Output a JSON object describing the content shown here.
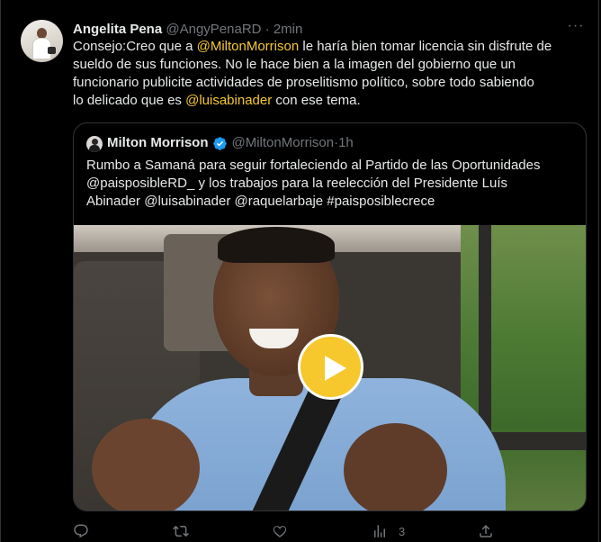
{
  "tweet": {
    "author_name": "Angelita Pena",
    "author_handle": "@AngyPenaRD",
    "separator": "·",
    "time": "2min",
    "more_label": "···",
    "text": {
      "line1_a": "Consejo:Creo que a ",
      "line1_mention": "@MiltonMorrison",
      "line1_b": " le haría bien tomar licencia sin disfrute de",
      "line2": "sueldo de sus funciones. No le hace bien a la imagen del gobierno que un",
      "line3": "funcionario publicite actividades de proselitismo político, sobre todo sabiendo",
      "line4_a": "lo delicado que es ",
      "line4_mention": "@luisabinader",
      "line4_b": " con ese tema."
    }
  },
  "quoted": {
    "author_name": "Milton Morrison",
    "author_handle": "@MiltonMorrison",
    "separator": "·",
    "time": "1h",
    "lines": [
      "Rumbo a Samaná para seguir fortaleciendo al Partido de las Oportunidades",
      "@paisposibleRD_ y los trabajos para la reelección del Presidente Luís",
      "Abinader @luisabinader @raquelarbaje #paisposiblecrece"
    ],
    "verified_color": "#1d9bf0"
  },
  "actions": {
    "reply_icon": "reply-icon",
    "retweet_icon": "retweet-icon",
    "like_icon": "heart-icon",
    "views_icon": "views-icon",
    "views_count": "3",
    "share_icon": "share-icon"
  },
  "colors": {
    "background": "#000000",
    "text": "#e7e9ea",
    "muted": "#71767b",
    "mention": "#f6c82d",
    "play_button": "#f6c82d",
    "border": "#2f3336"
  }
}
